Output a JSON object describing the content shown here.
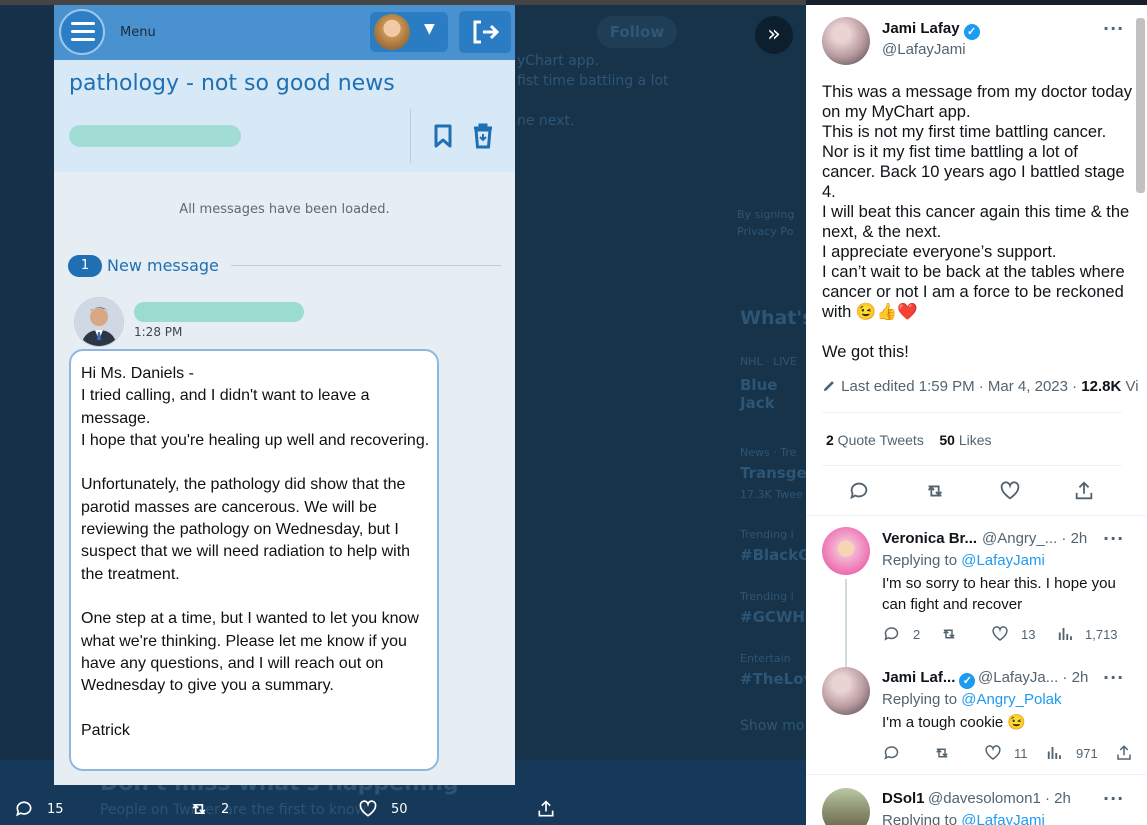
{
  "background": {
    "follow_label": "Follow",
    "bg_text_1": "yChart app.",
    "bg_text_2": "fist time battling a lot",
    "bg_text_3": "ne next.",
    "bg_whats": "What's",
    "bg_signing": "By signing",
    "bg_privacy": "Privacy Po",
    "bg_nhl": "NHL · LIVE",
    "bg_bluejack": "Blue Jack",
    "bg_news": "News · Tre",
    "bg_transgen": "Transgen",
    "bg_tweets": "17.3K Twee",
    "bg_trending1": "Trending i",
    "bg_blackg": "#BlackG",
    "bg_trending2": "Trending i",
    "bg_gcwh": "#GCWHo",
    "bg_entertain": "Entertain",
    "bg_thelov": "#TheLov",
    "bg_showmore": "Show mo",
    "promo_title": "Don't miss what's happening",
    "promo_sub": "People on Twitter are the first to know",
    "bottom_stats": {
      "replies": "15",
      "retweets": "2",
      "likes": "50"
    }
  },
  "mychart": {
    "menu_label": "Menu",
    "subject": "pathology - not so good news",
    "loaded_text": "All messages have been loaded.",
    "new_count": "1",
    "new_label": "New message",
    "time": "1:28 PM",
    "message_lines": [
      "Hi Ms. Daniels -",
      "I tried calling, and I didn't want to leave a message.",
      "I hope that you're healing up well and recovering.",
      "",
      "Unfortunately, the pathology did show that the parotid masses are cancerous. We will be reviewing the pathology on Wednesday, but I suspect that we will need radiation to help with the treatment.",
      "",
      "One step at a time, but I wanted to let you know what we're thinking.  Please let me know if you have any questions, and I will reach out on Wednesday to give you a summary.",
      "",
      "Patrick"
    ]
  },
  "tweet": {
    "author_name": "Jami Lafay",
    "author_handle": "@LafayJami",
    "text_lines": [
      "This was a message from my doctor today on my MyChart app.",
      "This is not my first time battling cancer. Nor is it my fist time battling a lot of cancer. Back 10 years ago I battled stage 4.",
      "I will beat this cancer again this time & the next, & the next.",
      "I appreciate everyone’s support.",
      "I can’t wait to be back at the tables where cancer or not I am a force to be reckoned with 😉👍❤️",
      "",
      "We got this!"
    ],
    "edited_text": "Last edited 1:59 PM · Mar 4, 2023 · ",
    "views": "12.8K",
    "views_suffix": " Vi",
    "quote_count": "2",
    "quote_label": " Quote Tweets",
    "likes_count": "50",
    "likes_label": " Likes"
  },
  "replies": [
    {
      "name": "Veronica Br...",
      "handle": "@Angry_... · 2h",
      "replying_prefix": "Replying to ",
      "replying_to": "@LafayJami",
      "text": "I'm so sorry to hear this. I hope you can fight and recover",
      "replies": "2",
      "retweets": "",
      "likes": "13",
      "views": "1,713"
    },
    {
      "name": "Jami Laf...",
      "handle": "@LafayJa... · 2h",
      "replying_prefix": "Replying to ",
      "replying_to": "@Angry_Polak",
      "text": "I'm a tough cookie 😉",
      "replies": "",
      "retweets": "",
      "likes": "11",
      "views": "971"
    },
    {
      "name": "DSol1",
      "handle": "@davesolomon1 · 2h",
      "replying_prefix": "Replying to ",
      "replying_to": "@LafayJami"
    }
  ],
  "colors": {
    "mychart_blue": "#1f6fb3",
    "twitter_blue": "#1d9bf0",
    "background_navy": "#16334a"
  }
}
